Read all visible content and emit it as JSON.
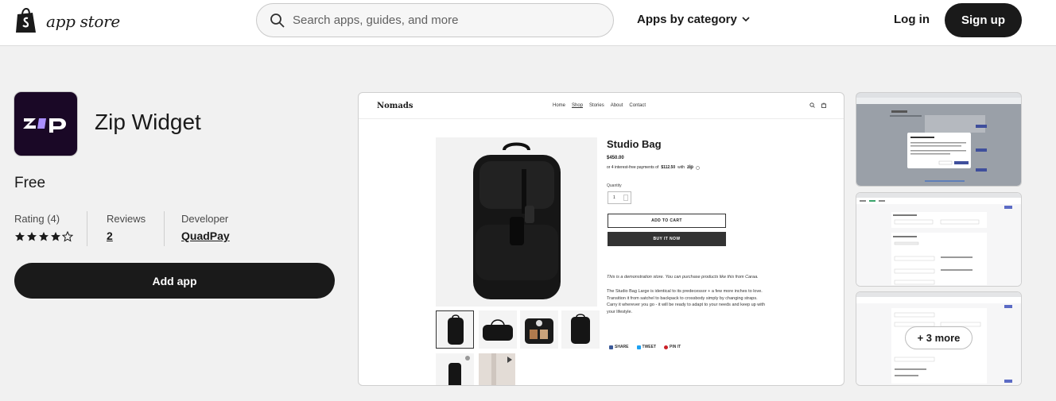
{
  "header": {
    "logo_text": "app store",
    "search_placeholder": "Search apps, guides, and more",
    "category_menu": "Apps by category",
    "login": "Log in",
    "signup": "Sign up"
  },
  "app": {
    "icon_text": "zip",
    "name": "Zip Widget",
    "price": "Free",
    "rating_label": "Rating (4)",
    "rating_value": 4.4,
    "reviews_label": "Reviews",
    "reviews_count": "2",
    "developer_label": "Developer",
    "developer_name": "QuadPay",
    "add_app": "Add app"
  },
  "screenshot_store": {
    "brand": "Nomads",
    "nav": [
      "Home",
      "Shop",
      "Stories",
      "About",
      "Contact"
    ],
    "product_title": "Studio Bag",
    "product_price": "$450.00",
    "installments_prefix": "or 4 interest-free payments of",
    "installment_amount": "$112.50",
    "installments_with": "with",
    "zip_mark": "zip",
    "quantity_label": "Quantity",
    "quantity_value": "1",
    "add_to_cart": "ADD TO CART",
    "buy_it_now": "BUY IT NOW",
    "demo_note": "This is a demonstration store. You can purchase products like this from Caraa.",
    "description": "The Studio Bag Large is identical to its predecessor + a few more inches to love. Transition it from satchel to backpack to crossbody simply by changing straps. Carry it wherever you go - it will be ready to adapt to your needs and keep up with your lifestyle.",
    "share": "SHARE",
    "tweet": "TWEET",
    "pin": "PIN IT"
  },
  "gallery": {
    "more_label": "+ 3 more"
  },
  "colors": {
    "brand_dark": "#1a1a1a",
    "zip_purple": "#aa8fff",
    "icon_bg": "#1a0826"
  }
}
